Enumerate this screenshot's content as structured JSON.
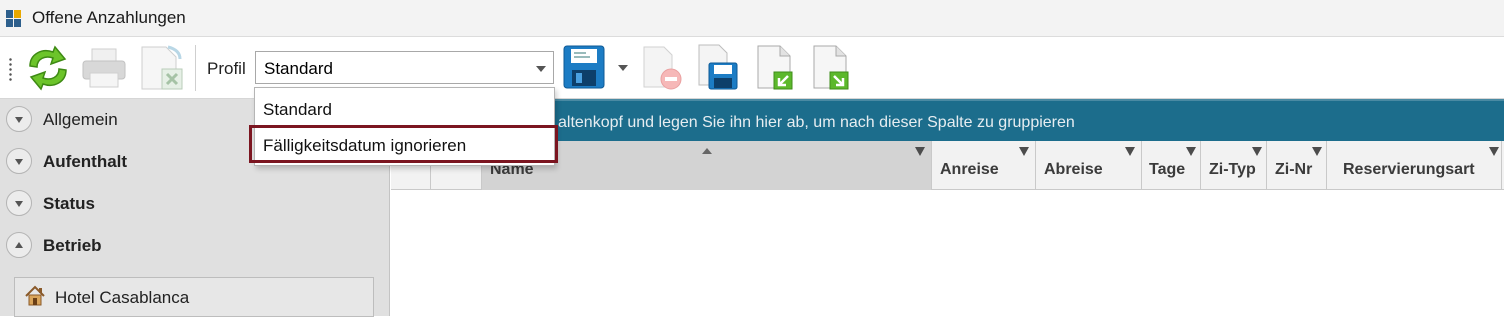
{
  "window": {
    "title": "Offene Anzahlungen",
    "app_icon": "app-grid-icon"
  },
  "toolbar": {
    "refresh_icon": "refresh-icon",
    "print_icon": "printer-icon",
    "excel_icon": "excel-export-icon",
    "profil_label": "Profil",
    "profil_value": "Standard",
    "save_icon": "floppy-disk-icon",
    "delete_icon": "delete-profile-icon",
    "save_as_icon": "save-as-icon",
    "import_icon": "import-icon",
    "export_icon": "export-icon"
  },
  "profil_dropdown": {
    "options": [
      "Standard",
      "Fälligkeitsdatum ignorieren"
    ],
    "highlighted_index": 1,
    "highlight_color": "#7b1520"
  },
  "sidebar": {
    "sections": [
      {
        "label": "Allgemein",
        "expanded": false,
        "bold": false
      },
      {
        "label": "Aufenthalt",
        "expanded": false,
        "bold": true
      },
      {
        "label": "Status",
        "expanded": false,
        "bold": true
      },
      {
        "label": "Betrieb",
        "expanded": true,
        "bold": true
      }
    ],
    "hotel": {
      "label": "Hotel Casablanca",
      "icon": "house-icon"
    }
  },
  "grid": {
    "group_hint": "altenkopf und legen Sie ihn hier ab, um nach dieser Spalte zu gruppieren",
    "columns": [
      "Name",
      "Anreise",
      "Abreise",
      "Tage",
      "Zi-Typ",
      "Zi-Nr",
      "Reservierungsart"
    ],
    "accent_color": "#1c6d8c"
  }
}
